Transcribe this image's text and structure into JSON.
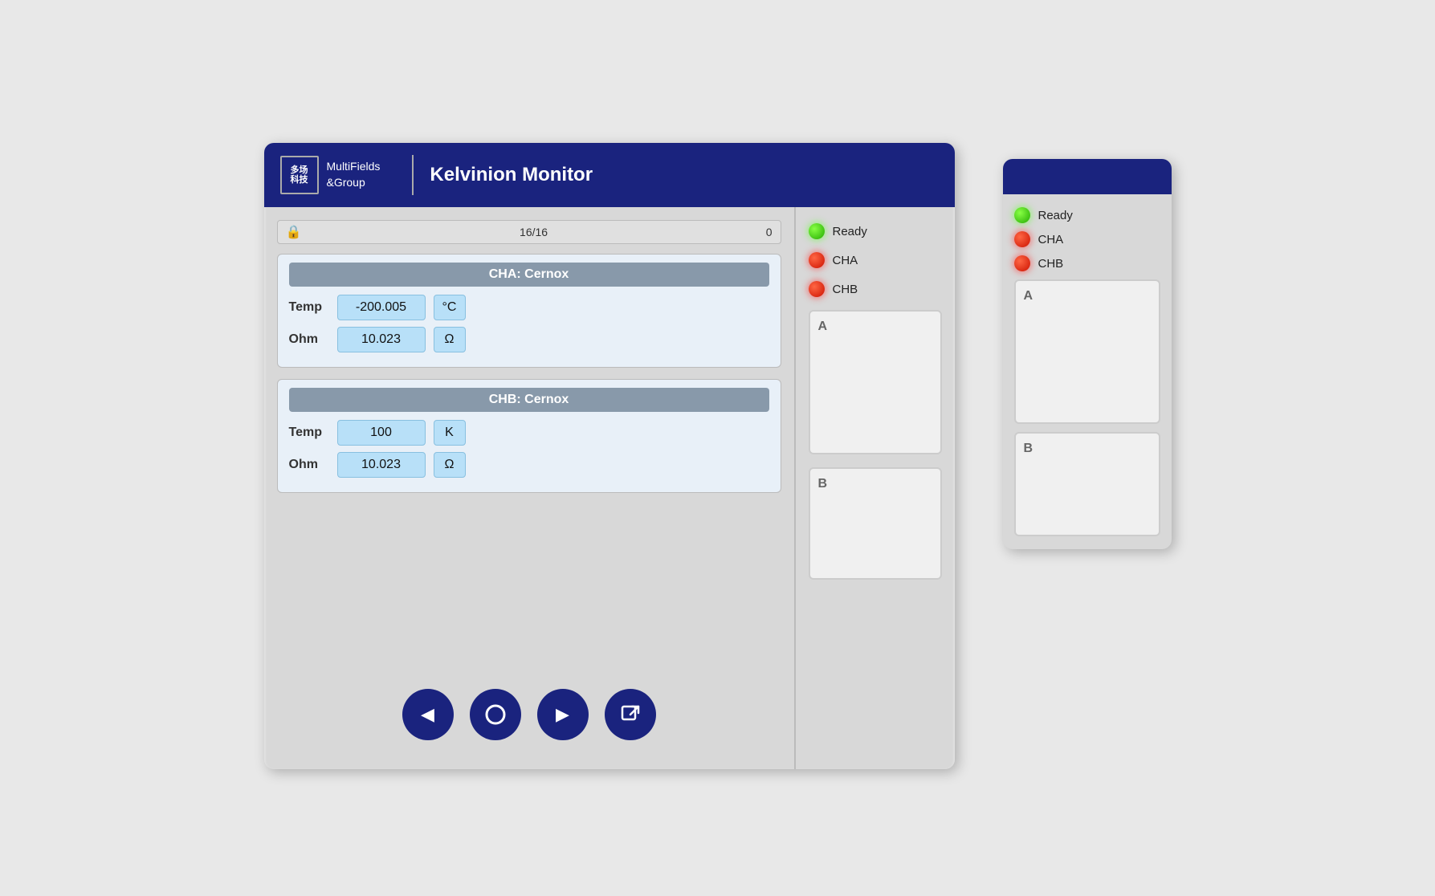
{
  "header": {
    "logo_text": "多场\n科技",
    "company_name": "MultiFields\n&Group",
    "title": "Kelvinion Monitor"
  },
  "status_bar": {
    "count": "16/16",
    "zero": "0"
  },
  "channel_a": {
    "title": "CHA:  Cernox",
    "temp_label": "Temp",
    "temp_value": "-200.005",
    "temp_unit": "°C",
    "ohm_label": "Ohm",
    "ohm_value": "10.023",
    "ohm_unit": "Ω"
  },
  "channel_b": {
    "title": "CHB:  Cernox",
    "temp_label": "Temp",
    "temp_value": "100",
    "temp_unit": "K",
    "ohm_label": "Ohm",
    "ohm_value": "10.023",
    "ohm_unit": "Ω"
  },
  "nav_buttons": {
    "back": "◀",
    "circle": "○",
    "play": "▶",
    "export": "↗"
  },
  "indicators": {
    "ready": "Ready",
    "cha": "CHA",
    "chb": "CHB"
  },
  "slots": {
    "a_label": "A",
    "b_label": "B"
  }
}
